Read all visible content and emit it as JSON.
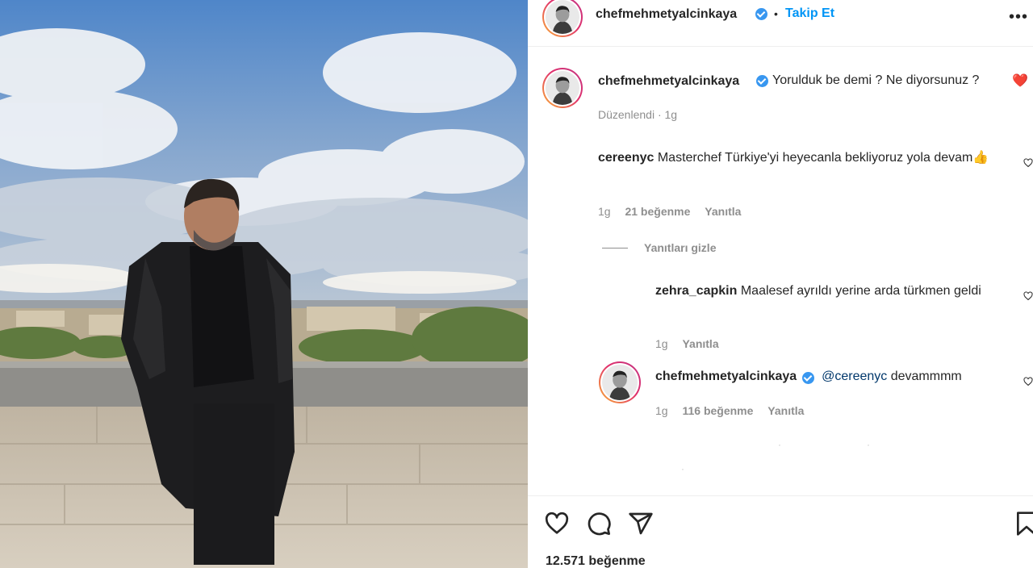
{
  "post": {
    "username": "chefmehmetyalcinkaya",
    "follow_label": "Takip Et",
    "dot": "•"
  },
  "caption": {
    "username": "chefmehmetyalcinkaya",
    "text": "Yorulduk be demi ? Ne diyorsunuz ?",
    "emoji": "❤️",
    "edited": "Düzenlendi",
    "time": "1g"
  },
  "comments": [
    {
      "username": "cereenyc",
      "text": "Masterchef Türkiye'yi heyecanla bekliyoruz yola devam👍",
      "time": "1g",
      "likes": "21 beğenme",
      "reply": "Yanıtla"
    }
  ],
  "hide_replies": "Yanıtları gizle",
  "replies": [
    {
      "username": "zehra_capkin",
      "text": "Maalesef ayrıldı yerine arda türkmen geldi",
      "time": "1g",
      "reply": "Yanıtla"
    },
    {
      "username": "chefmehmetyalcinkaya",
      "mention": "@cereenyc",
      "text": "devammmm",
      "time": "1g",
      "likes": "116 beğenme",
      "reply": "Yanıtla"
    }
  ],
  "footer": {
    "likes": "12.571 beğenme",
    "icons": [
      "heart-icon",
      "comment-icon",
      "share-icon",
      "bookmark-icon"
    ]
  },
  "colors": {
    "accent": "#0095f6",
    "verified": "#3897f0",
    "muted": "#8e8e8e",
    "heart": "#ed4956"
  }
}
